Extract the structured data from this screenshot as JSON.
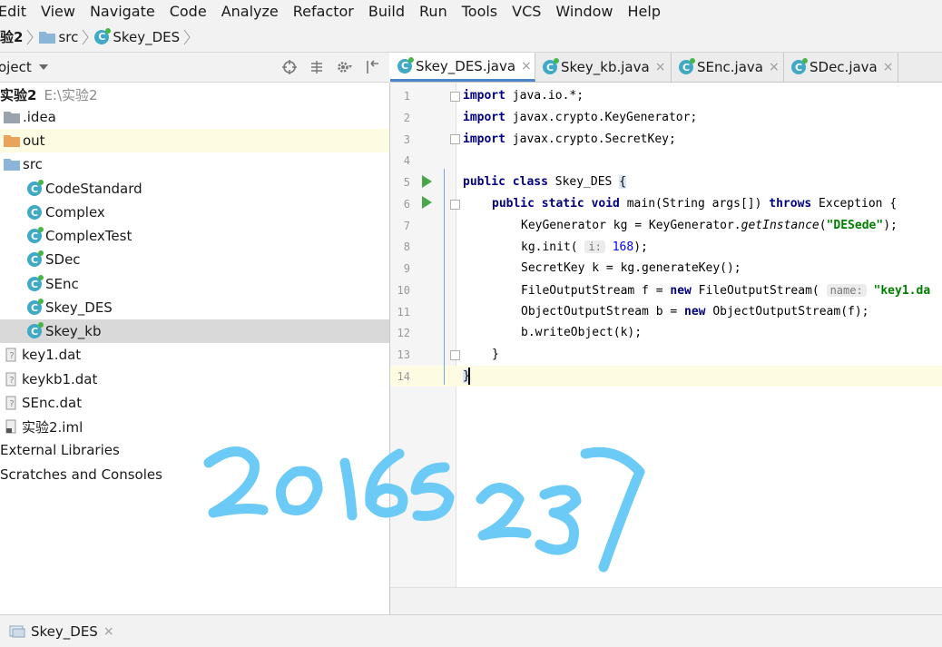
{
  "menu": [
    "Edit",
    "View",
    "Navigate",
    "Code",
    "Analyze",
    "Refactor",
    "Build",
    "Run",
    "Tools",
    "VCS",
    "Window",
    "Help"
  ],
  "breadcrumb": {
    "project": "验2",
    "folder": "src",
    "file": "Skey_DES"
  },
  "project_panel": {
    "title": "oject",
    "root_name": "实验2",
    "root_path": "E:\\实验2",
    "items": [
      ".idea",
      "out",
      "src",
      "CodeStandard",
      "Complex",
      "ComplexTest",
      "SDec",
      "SEnc",
      "Skey_DES",
      "Skey_kb",
      "key1.dat",
      "keykb1.dat",
      "SEnc.dat",
      "实验2.iml",
      "External Libraries",
      "Scratches and Consoles"
    ]
  },
  "tabs": [
    {
      "label": "Skey_DES.java",
      "close": "×"
    },
    {
      "label": "Skey_kb.java",
      "close": "×"
    },
    {
      "label": "SEnc.java",
      "close": "×"
    },
    {
      "label": "SDec.java",
      "close": "×"
    }
  ],
  "code": {
    "line_numbers": [
      "1",
      "2",
      "3",
      "4",
      "5",
      "6",
      "7",
      "8",
      "9",
      "10",
      "11",
      "12",
      "13",
      "14"
    ],
    "l1": {
      "kw": "import",
      "rest": " java.io.*;"
    },
    "l2": {
      "kw": "import",
      "rest": " javax.crypto.KeyGenerator;"
    },
    "l3": {
      "kw": "import",
      "rest": " javax.crypto.SecretKey;"
    },
    "l5": {
      "kw": "public class",
      "rest": " Skey_DES ",
      "brace": "{"
    },
    "l6": {
      "kw": "public static void",
      "a": " main(String args[]) ",
      "kw2": "throws",
      "b": " Exception {"
    },
    "l7": {
      "a": "KeyGenerator kg = KeyGenerator.",
      "it": "getInstance",
      "b": "(",
      "str": "\"DESede\"",
      "c": ");"
    },
    "l8": {
      "a": "kg.init( ",
      "hint": "i:",
      "num": " 168",
      "b": ");"
    },
    "l9": {
      "a": "SecretKey k = kg.generateKey();"
    },
    "l10": {
      "a": "FileOutputStream f = ",
      "kw": "new",
      "b": " FileOutputStream( ",
      "hint": "name:",
      "str": " \"key1.da"
    },
    "l11": {
      "a": "ObjectOutputStream b = ",
      "kw": "new",
      "b": " ObjectOutputStream(f);"
    },
    "l12": {
      "a": "b.writeObject(k);"
    },
    "l13": {
      "a": "}"
    },
    "l14": {
      "a": "}"
    }
  },
  "bottom_tab": {
    "label": "Skey_DES",
    "close": "×"
  },
  "handwriting": "20165237",
  "colors": {
    "accent": "#4a86c8",
    "class_icon": "#3fa9c6",
    "run": "#4aa84a",
    "keyword": "#000080",
    "string": "#008000",
    "number": "#0000ff",
    "handwriting": "#6ccaf6"
  }
}
